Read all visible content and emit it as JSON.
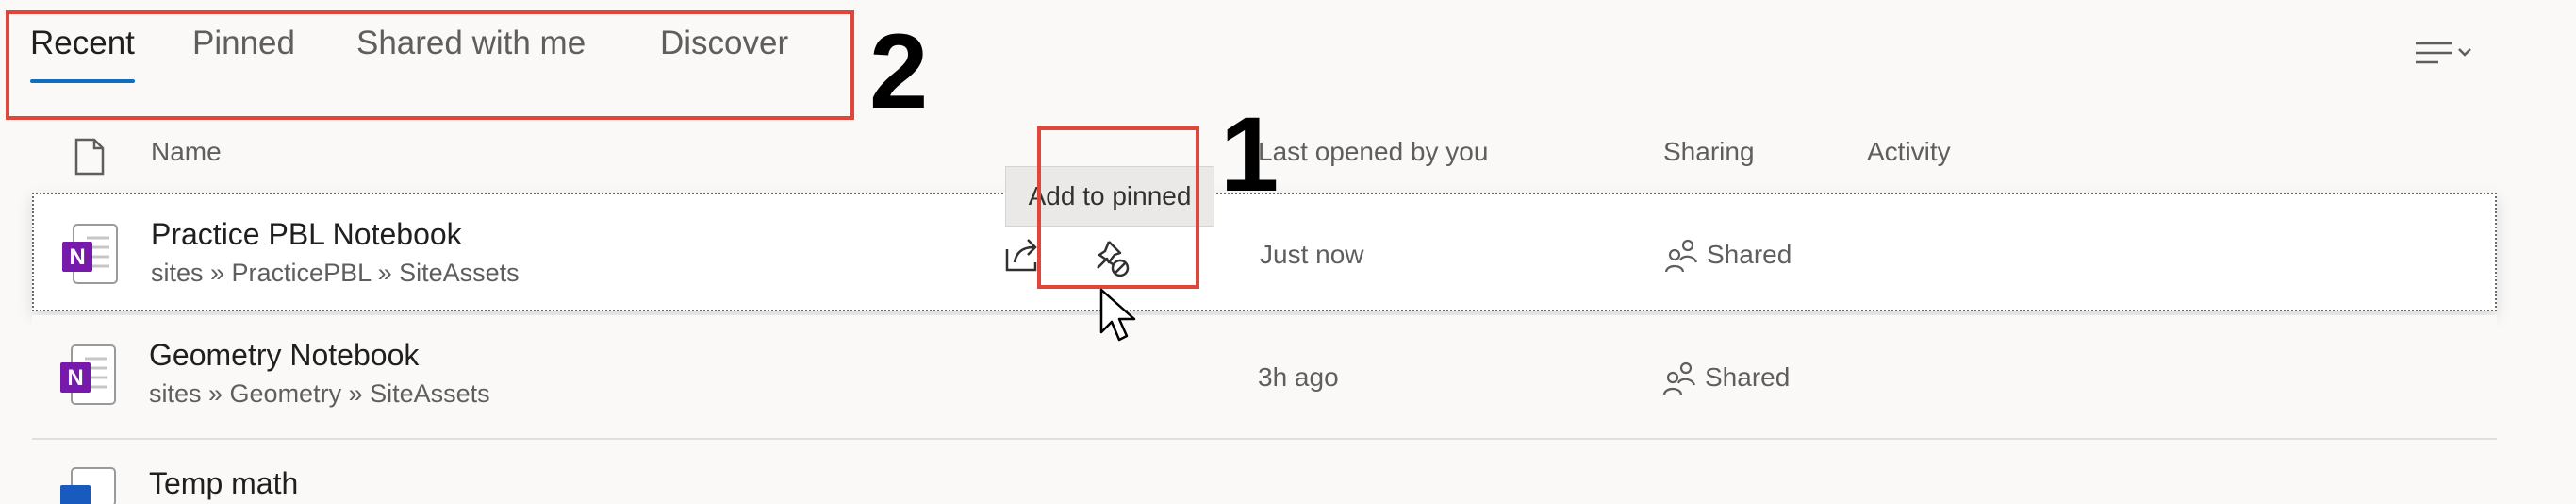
{
  "tabs": [
    {
      "label": "Recent",
      "active": true
    },
    {
      "label": "Pinned",
      "active": false
    },
    {
      "label": "Shared with me",
      "active": false
    },
    {
      "label": "Discover",
      "active": false
    }
  ],
  "annotations": {
    "tabs_number": "2",
    "pin_number": "1"
  },
  "toolbar": {
    "view_icon": "list-view-icon"
  },
  "columns": {
    "name": "Name",
    "last_opened": "Last opened by you",
    "sharing": "Sharing",
    "activity": "Activity"
  },
  "tooltip": "Add to pinned",
  "files": [
    {
      "name": "Practice PBL Notebook",
      "path": "sites » PracticePBL » SiteAssets",
      "last_opened": "Just now",
      "sharing": "Shared",
      "icon": "onenote-icon"
    },
    {
      "name": "Geometry Notebook",
      "path": "sites » Geometry » SiteAssets",
      "last_opened": "3h ago",
      "sharing": "Shared",
      "icon": "onenote-icon"
    },
    {
      "name": "Temp math",
      "icon": "document-icon"
    }
  ],
  "colors": {
    "accent": "#106ebe",
    "onenote": "#7719aa",
    "annotation": "#e0463a"
  }
}
